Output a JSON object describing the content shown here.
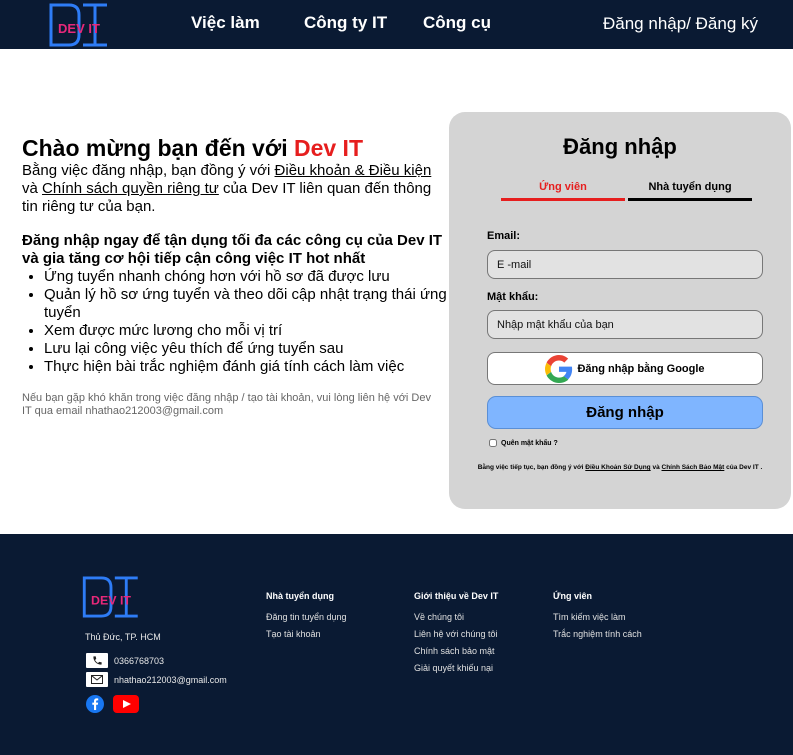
{
  "header": {
    "logo_text": "DEV IT",
    "nav": [
      "Việc làm",
      "Công ty IT",
      "Công cụ"
    ],
    "login_link": "Đăng nhập/ Đăng ký"
  },
  "intro": {
    "welcome_prefix": "Chào mừng bạn đến với ",
    "welcome_brand": "Dev IT",
    "p1_a": "Bằng việc đăng nhập, bạn đồng ý với ",
    "p1_link1": "Điều khoản & Điều kiện",
    "p1_b": " và ",
    "p1_link2": "Chính sách quyền riêng tư",
    "p1_c": " của Dev IT liên quan đến thông tin riêng tư của bạn.",
    "benefit_title": "Đăng nhập ngay để tận dụng tối đa các công cụ của Dev IT và gia tăng cơ hội tiếp cận công việc IT hot nhất",
    "benefits": [
      "Ứng tuyển nhanh chóng hơn với hồ sơ đã được lưu",
      "Quản lý hồ sơ ứng tuyển và theo dõi cập nhật trạng thái ứng tuyển",
      "Xem được mức lương cho mỗi vị trí",
      "Lưu lại công việc yêu thích để ứng tuyển sau",
      "Thực hiện bài trắc nghiệm đánh giá tính cách làm việc"
    ],
    "contact_note": "Nếu bạn gặp khó khăn trong việc đăng nhập / tạo tài khoản, vui lòng liên hệ với Dev IT qua email nhathao212003@gmail.com"
  },
  "login": {
    "title": "Đăng nhập",
    "tabs": [
      "Ứng viên",
      "Nhà tuyển dụng"
    ],
    "email_label": "Email:",
    "email_placeholder": "E -mail",
    "password_label": "Mật khẩu:",
    "password_placeholder": "Nhập mật khẩu của bạn",
    "google_label": "Đăng nhập bằng Google",
    "submit_label": "Đăng nhập",
    "forgot_label": "Quên mật khẩu ?",
    "terms_a": "Bằng việc tiếp tục, bạn đồng ý với ",
    "terms_link1": "Điều Khoản Sử Dụng",
    "terms_b": " và ",
    "terms_link2": "Chính Sách Bảo Mật",
    "terms_c": " của Dev IT ."
  },
  "footer": {
    "address": "Thủ Đức, TP. HCM",
    "phone": "0366768703",
    "email": "nhathao212003@gmail.com",
    "columns": [
      {
        "title": "Nhà tuyển dụng",
        "links": [
          "Đăng tin tuyển dụng",
          "Tạo tài khoản"
        ]
      },
      {
        "title": "Giới thiệu về Dev IT",
        "links": [
          "Về chúng tôi",
          "Liên hệ với chúng tôi",
          "Chính sách bảo mật",
          "Giải quyết khiếu nại"
        ]
      },
      {
        "title": "Ứng viên",
        "links": [
          "Tìm kiếm việc làm",
          "Trắc nghiệm tính cách"
        ]
      }
    ]
  },
  "colors": {
    "navy": "#0a1a33",
    "brand_red": "#e61e1e",
    "accent_blue": "#7fb5ff",
    "logo_pink": "#e8287a",
    "logo_blue": "#2e7cf6"
  },
  "icons": [
    "logo",
    "phone-icon",
    "mail-icon",
    "google-icon",
    "facebook-icon",
    "youtube-icon"
  ]
}
